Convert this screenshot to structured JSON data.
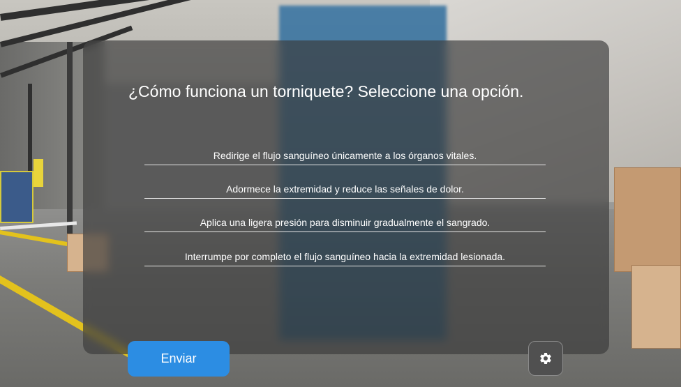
{
  "quiz": {
    "question": "¿Cómo funciona un torniquete? Seleccione una opción.",
    "options": [
      "Redirige el flujo sanguíneo únicamente a los órganos vitales.",
      "Adormece la extremidad y reduce las señales de dolor.",
      "Aplica una ligera presión para disminuir gradualmente el sangrado.",
      "Interrumpe por completo el flujo sanguíneo hacia la extremidad lesionada."
    ]
  },
  "controls": {
    "submit_label": "Enviar",
    "settings_icon": "gear-icon"
  },
  "colors": {
    "submit_button": "#2c8de3",
    "panel_overlay": "#3a3a3a",
    "text": "#ffffff"
  }
}
